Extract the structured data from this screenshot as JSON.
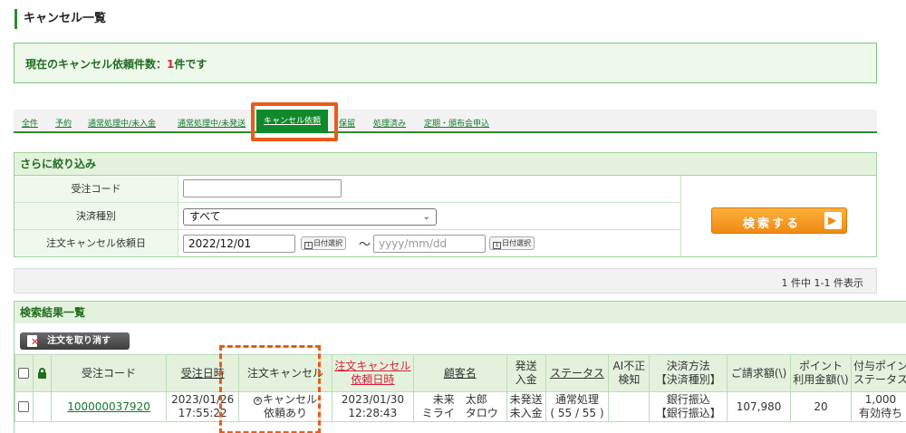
{
  "page_title": "キャンセル一覧",
  "summary": {
    "prefix": "現在のキャンセル依頼件数：",
    "count": "1",
    "suffix": "件です"
  },
  "tabs": [
    "全件",
    "予約",
    "通常処理中/未入金",
    "通常処理中/未発送",
    "キャンセル依頼",
    "保留",
    "処理済み",
    "定期・頒布会申込"
  ],
  "active_tab": "キャンセル依頼",
  "filter": {
    "title": "さらに絞り込み",
    "order_code_label": "受注コード",
    "order_code_value": "",
    "payment_label": "決済種別",
    "payment_value": "すべて",
    "cancel_date_label": "注文キャンセル依頼日",
    "date_from": "2022/12/01",
    "date_pick_label": "日付選択",
    "date_separator": "〜",
    "date_to_placeholder": "yyyy/mm/dd",
    "search_button": "検索する"
  },
  "result_count": "1 件中 1-1 件表示",
  "results": {
    "title": "検索結果一覧",
    "cancel_order_button": "注文を取り消す",
    "headers": {
      "order_code": "受注コード",
      "order_datetime": "受注日時",
      "order_cancel": "注文キャンセル",
      "cancel_request_1": "注文キャンセル",
      "cancel_request_2": "依頼日時",
      "customer": "顧客名",
      "ship_1": "発送",
      "ship_2": "入金",
      "status": "ステータス",
      "ai_1": "AI不正",
      "ai_2": "検知",
      "pay_1": "決済方法",
      "pay_2": "【決済種別】",
      "amount": "ご請求額(\\)",
      "point_1": "ポイント",
      "point_2": "利用金額(\\)",
      "grant_1": "付与ポイン",
      "grant_2": "ステータス"
    },
    "row": {
      "order_code": "100000037920",
      "order_date": "2023/01/26",
      "order_time": "17:55:22",
      "cancel_1": "キャンセル",
      "cancel_2": "依頼あり",
      "cancel_date": "2023/01/30",
      "cancel_time": "12:28:43",
      "customer_1": "未来　太郎",
      "customer_2": "ミライ　タロウ",
      "ship_1": "未発送",
      "ship_2": "未入金",
      "status_1": "通常処理",
      "status_2": "( 55 / 55 )",
      "ai": "",
      "pay_1": "銀行振込",
      "pay_2": "【銀行振込】",
      "amount": "107,980",
      "points": "20",
      "grant_1": "1,000",
      "grant_2": "有効待ち"
    }
  },
  "colors": {
    "accent": "#2e8b2e",
    "active_tab": "#0f8a2a",
    "highlight": "#ea5b18",
    "search_button": "#ef8a12",
    "sort_link": "#d6213a"
  },
  "icons": {
    "lock": "lock-icon",
    "calendar": "calendar-icon",
    "cancel": "cancel-circle-icon",
    "arrow": "arrow-right-icon",
    "document": "document-icon"
  }
}
